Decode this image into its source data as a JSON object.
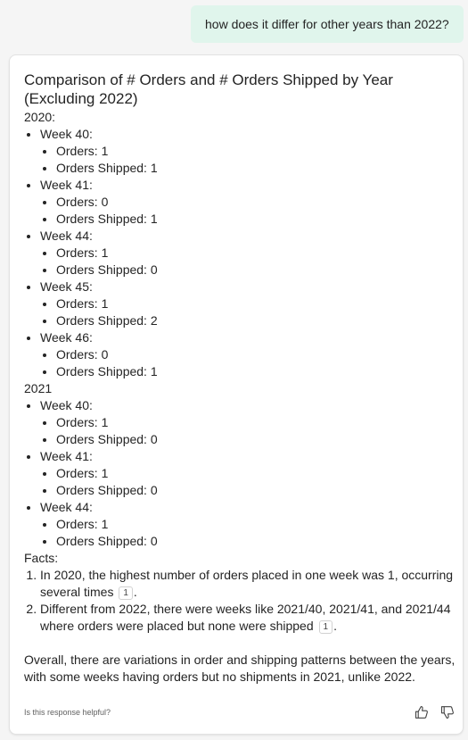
{
  "user_message": "how does it differ for other years than 2022?",
  "response": {
    "heading": "Comparison of # Orders and # Orders Shipped by Year (Excluding 2022)",
    "years": [
      {
        "label": "2020:",
        "weeks": [
          {
            "label": "Week 40:",
            "items": [
              "Orders: 1",
              "Orders Shipped: 1"
            ]
          },
          {
            "label": "Week 41:",
            "items": [
              "Orders: 0",
              "Orders Shipped: 1"
            ]
          },
          {
            "label": "Week 44:",
            "items": [
              "Orders: 1",
              "Orders Shipped: 0"
            ]
          },
          {
            "label": "Week 45:",
            "items": [
              "Orders: 1",
              "Orders Shipped: 2"
            ]
          },
          {
            "label": "Week 46:",
            "items": [
              "Orders: 0",
              "Orders Shipped: 1"
            ]
          }
        ]
      },
      {
        "label": "2021",
        "weeks": [
          {
            "label": "Week 40:",
            "items": [
              "Orders: 1",
              "Orders Shipped: 0"
            ]
          },
          {
            "label": "Week 41:",
            "items": [
              "Orders: 1",
              "Orders Shipped: 0"
            ]
          },
          {
            "label": "Week 44:",
            "items": [
              "Orders: 1",
              "Orders Shipped: 0"
            ]
          }
        ]
      }
    ],
    "facts_label": "Facts:",
    "facts": [
      {
        "text": "In 2020, the highest number of orders placed in one week was 1, occurring several times",
        "citation": "1",
        "end": "."
      },
      {
        "text": "Different from 2022, there were weeks like 2021/40, 2021/41, and 2021/44 where orders were placed but none were shipped",
        "citation": "1",
        "end": "."
      }
    ],
    "summary": "Overall, there are variations in order and shipping patterns between the years, with some weeks having orders but no shipments in 2021, unlike 2022."
  },
  "footer": {
    "helpful_prompt": "Is this response helpful?",
    "thumbs_up_icon": "thumbs-up-icon",
    "thumbs_down_icon": "thumbs-down-icon"
  }
}
